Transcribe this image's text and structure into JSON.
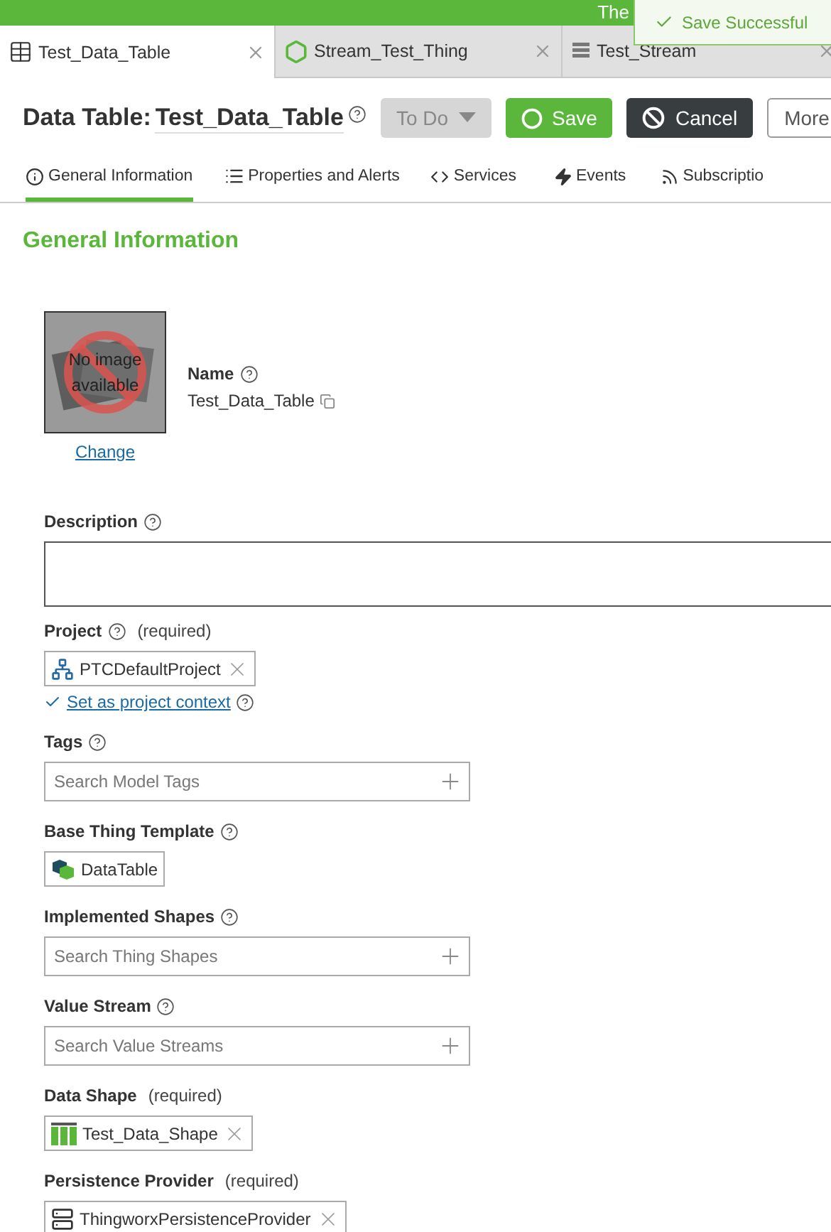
{
  "banner": {
    "text": "The"
  },
  "toast": {
    "text": "Save Successful"
  },
  "tabs": [
    {
      "label": "Test_Data_Table",
      "selected": true,
      "kind": "table"
    },
    {
      "label": "Stream_Test_Thing",
      "selected": false,
      "kind": "thing"
    },
    {
      "label": "Test_Stream",
      "selected": false,
      "kind": "stream"
    }
  ],
  "header": {
    "type_label": "Data Table:",
    "name": "Test_Data_Table",
    "state_button": {
      "label": "To Do",
      "disabled": true
    },
    "buttons": [
      {
        "label": "Save",
        "kind": "save"
      },
      {
        "label": "Cancel",
        "kind": "cancel"
      },
      {
        "label": "More",
        "kind": "more"
      }
    ]
  },
  "sections": [
    {
      "label": "General Information",
      "selected": true,
      "kind": "info"
    },
    {
      "label": "Properties and Alerts",
      "selected": false,
      "kind": "list"
    },
    {
      "label": "Services",
      "selected": false,
      "kind": "code"
    },
    {
      "label": "Events",
      "selected": false,
      "kind": "bolt"
    },
    {
      "label": "Subscriptio",
      "selected": false,
      "kind": "feed"
    }
  ],
  "section_title": "General Information",
  "image": {
    "placeholder": "No image available",
    "link": "Change"
  },
  "name": {
    "label": "Name",
    "value": "Test_Data_Table"
  },
  "fields": [
    {
      "kind": "textarea",
      "label": "Description",
      "help": true
    },
    {
      "kind": "chip",
      "label": "Project",
      "help": true,
      "required": "(required)",
      "chip": {
        "text": "PTCDefaultProject",
        "kind": "project",
        "removable": true
      },
      "link": "Set as project context"
    },
    {
      "kind": "search",
      "label": "Tags",
      "help": true,
      "placeholder": "Search Model Tags"
    },
    {
      "kind": "chip",
      "label": "Base Thing Template",
      "help": true,
      "chip": {
        "text": "DataTable",
        "kind": "template",
        "removable": false
      }
    },
    {
      "kind": "search",
      "label": "Implemented Shapes",
      "help": true,
      "placeholder": "Search Thing Shapes"
    },
    {
      "kind": "search",
      "label": "Value Stream",
      "help": true,
      "placeholder": "Search Value Streams"
    },
    {
      "kind": "chip",
      "label": "Data Shape",
      "help": false,
      "required": "(required)",
      "chip": {
        "text": "Test_Data_Shape",
        "kind": "shape",
        "removable": true
      }
    },
    {
      "kind": "chip",
      "label": "Persistence Provider",
      "help": false,
      "required": "(required)",
      "chip": {
        "text": "ThingworxPersistenceProvider",
        "kind": "server",
        "removable": true
      }
    }
  ]
}
